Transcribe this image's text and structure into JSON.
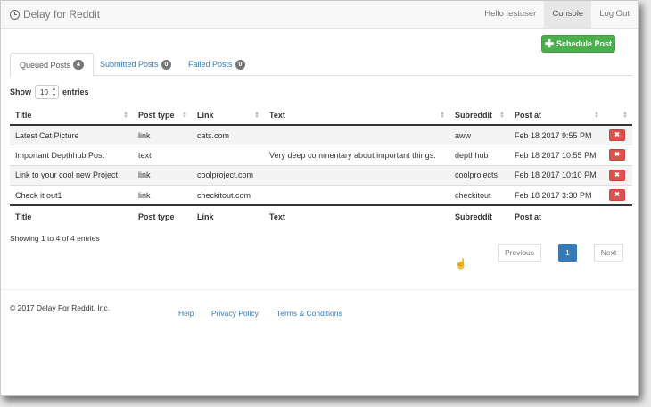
{
  "navbar": {
    "brand": "Delay for Reddit",
    "greeting": "Hello testuser",
    "console": "Console",
    "logout": "Log Out"
  },
  "schedule_button": "Schedule Post",
  "tabs": [
    {
      "label": "Queued Posts",
      "count": "4"
    },
    {
      "label": "Submitted Posts",
      "count": "0"
    },
    {
      "label": "Failed Posts",
      "count": "0"
    }
  ],
  "length": {
    "show": "Show",
    "value": "10",
    "entries": "entries"
  },
  "table": {
    "headers": [
      "Title",
      "Post type",
      "Link",
      "Text",
      "Subreddit",
      "Post at"
    ],
    "rows": [
      {
        "title": "Latest Cat Picture",
        "type": "link",
        "link": "cats.com",
        "text": "",
        "subreddit": "aww",
        "post_at": "Feb 18 2017 9:55 PM"
      },
      {
        "title": "Important Depthhub Post",
        "type": "text",
        "link": "",
        "text": "Very deep commentary about important things.",
        "subreddit": "depthhub",
        "post_at": "Feb 18 2017 10:55 PM"
      },
      {
        "title": "Link to your cool new Project",
        "type": "link",
        "link": "coolproject.com",
        "text": "",
        "subreddit": "coolprojects",
        "post_at": "Feb 18 2017 10:10 PM"
      },
      {
        "title": "Check it out1",
        "type": "link",
        "link": "checkitout.com",
        "text": "",
        "subreddit": "checkitout",
        "post_at": "Feb 18 2017 3:30 PM"
      }
    ],
    "delete_glyph": "✖"
  },
  "info": "Showing 1 to 4 of 4 entries",
  "pagination": {
    "previous": "Previous",
    "page": "1",
    "next": "Next"
  },
  "footer": {
    "copyright": "© 2017 Delay For Reddit, Inc.",
    "links": [
      "Help",
      "Privacy Policy",
      "Terms & Conditions"
    ]
  },
  "colors": {
    "success": "#4cae4c",
    "danger": "#d9534f",
    "link": "#337ab7"
  }
}
